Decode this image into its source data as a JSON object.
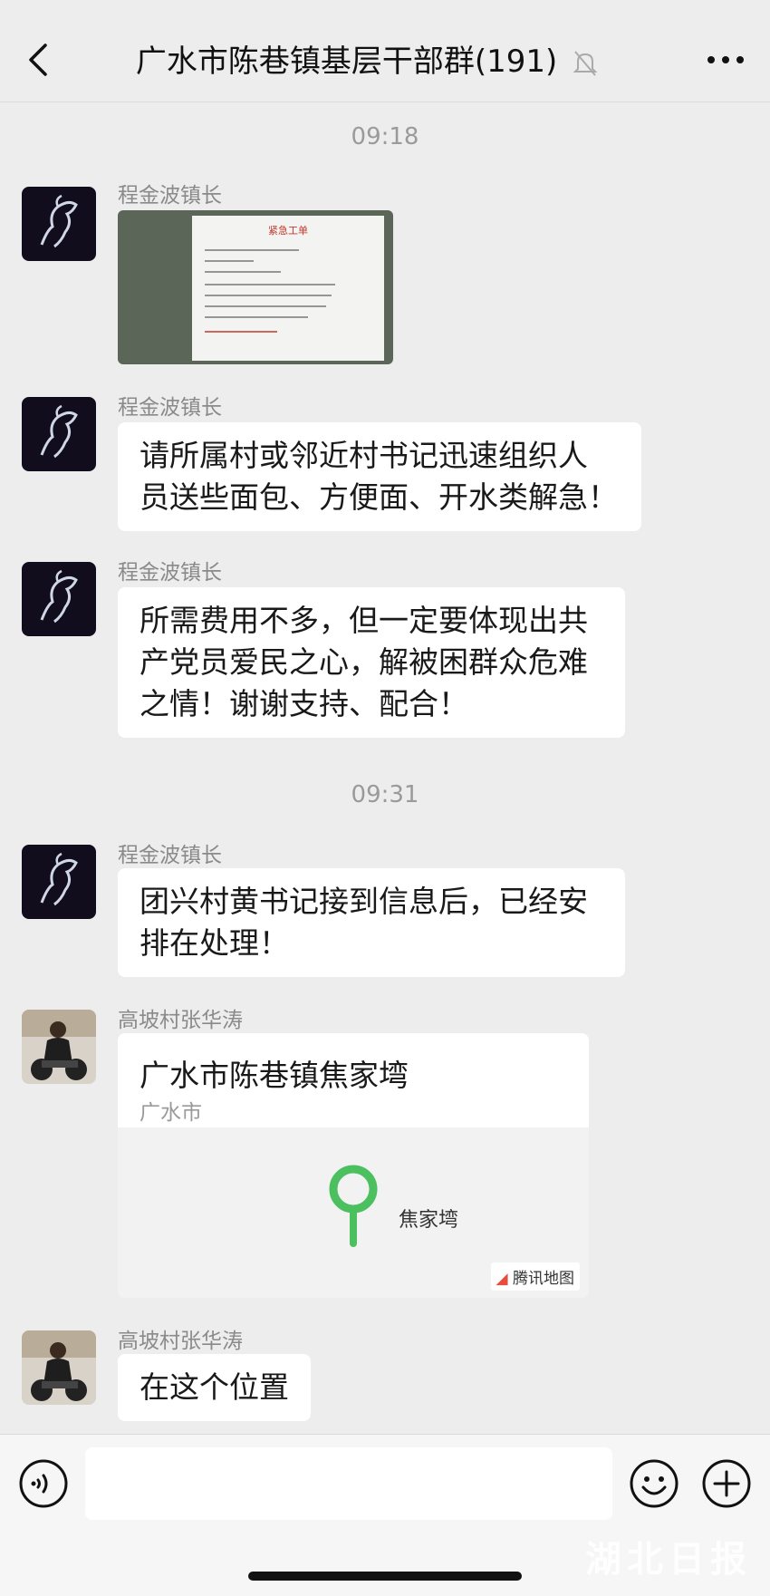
{
  "header": {
    "title": "广水市陈巷镇基层干部群(191)",
    "back_icon": "chevron-left-icon",
    "mute_icon": "bell-off-icon",
    "more_icon": "more-dots-icon"
  },
  "timestamps": [
    "09:18",
    "09:31"
  ],
  "messages": [
    {
      "sender": "程金波镇长",
      "type": "image",
      "image_title": "紧急工单"
    },
    {
      "sender": "程金波镇长",
      "type": "text",
      "lines": [
        "请所属村或邻近村书记迅速组织人",
        "员送些面包、方便面、开水类解急！"
      ]
    },
    {
      "sender": "程金波镇长",
      "type": "text",
      "lines": [
        "所需费用不多，但一定要体现出共",
        "产党员爱民之心，解被困群众危难",
        "之情！谢谢支持、配合！"
      ]
    },
    {
      "sender": "程金波镇长",
      "type": "text",
      "lines": [
        "团兴村黄书记接到信息后，已经安",
        "排在处理！"
      ]
    },
    {
      "sender": "高坡村张华涛",
      "type": "location",
      "location_title": "广水市陈巷镇焦家塆",
      "location_sub": "广水市",
      "map_label": "焦家塆",
      "map_brand": "腾讯地图"
    },
    {
      "sender": "高坡村张华涛",
      "type": "text",
      "lines": [
        "在这个位置"
      ]
    }
  ],
  "input": {
    "placeholder": "",
    "voice_icon": "voice-icon",
    "emoji_icon": "emoji-icon",
    "plus_icon": "plus-icon"
  },
  "watermark": "湖北日报",
  "colors": {
    "background": "#ededed",
    "bubble": "#ffffff",
    "map_pin": "#4cbf5e"
  }
}
